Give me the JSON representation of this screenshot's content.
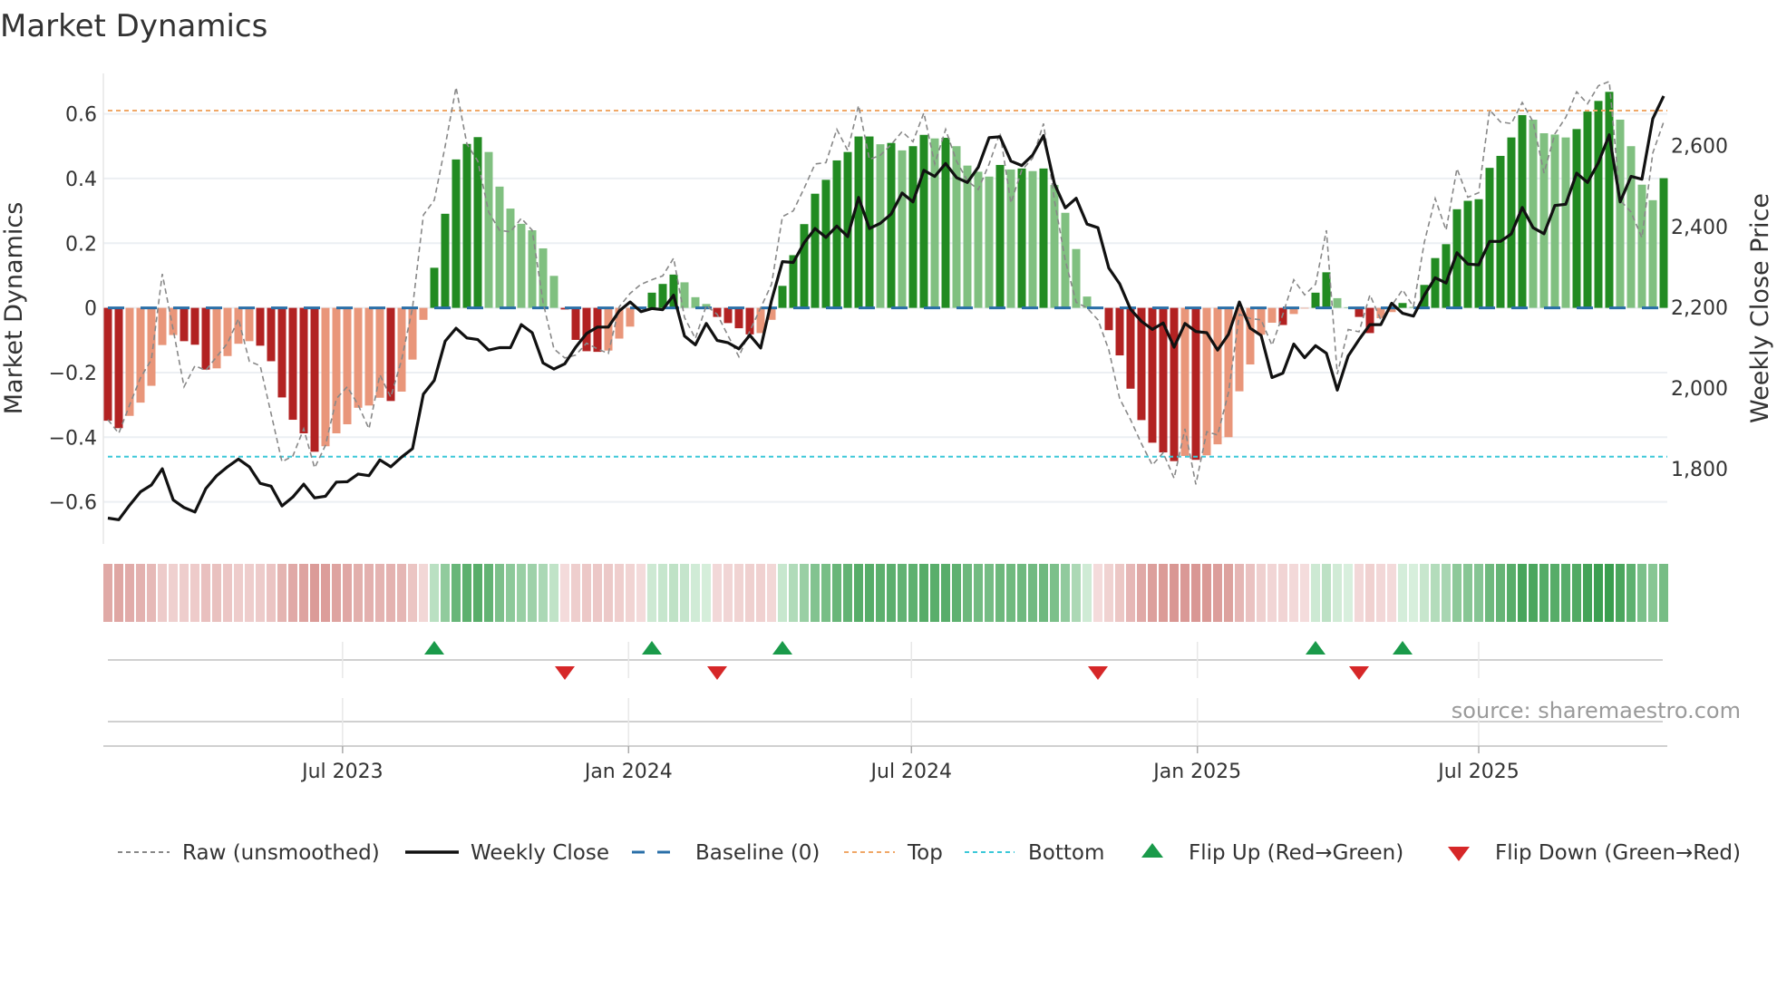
{
  "title": "Market Dynamics",
  "source": "source: sharemaestro.com",
  "colors": {
    "bar_pos_strong": "#228b22",
    "bar_pos_weak": "#80c080",
    "bar_neg_strong": "#b22222",
    "bar_neg_weak": "#e9967a",
    "raw": "#888888",
    "close": "#111111",
    "baseline": "#2a6fa8",
    "top": "#f0a868",
    "bottom": "#3cc8d8",
    "flip_up": "#1a9a4a",
    "flip_down": "#d62728",
    "grid": "#eceff3",
    "axis": "#d0d0d0"
  },
  "chart_data": {
    "type": "bar",
    "title": "Market Dynamics",
    "ylabel": "Market Dynamics",
    "y2label": "Weekly Close Price",
    "frequency": "weekly",
    "start_date": "2023-01-31",
    "ylim": [
      -0.73,
      0.725
    ],
    "y2lim": [
      1614,
      2779
    ],
    "yticks": [
      {
        "value": -0.6,
        "label": "−0.6"
      },
      {
        "value": -0.4,
        "label": "−0.4"
      },
      {
        "value": -0.2,
        "label": "−0.2"
      },
      {
        "value": 0,
        "label": "0"
      },
      {
        "value": 0.2,
        "label": "0.2"
      },
      {
        "value": 0.4,
        "label": "0.4"
      },
      {
        "value": 0.6,
        "label": "0.6"
      }
    ],
    "y2ticks": [
      {
        "value": 1800,
        "label": "1,800"
      },
      {
        "value": 2000,
        "label": "2,000"
      },
      {
        "value": 2200,
        "label": "2,200"
      },
      {
        "value": 2400,
        "label": "2,400"
      },
      {
        "value": 2600,
        "label": "2,600"
      }
    ],
    "xticks": [
      {
        "date": "2023-07-01",
        "label": "Jul 2023"
      },
      {
        "date": "2024-01-01",
        "label": "Jan 2024"
      },
      {
        "date": "2024-07-01",
        "label": "Jul 2024"
      },
      {
        "date": "2025-01-01",
        "label": "Jan 2025"
      },
      {
        "date": "2025-07-01",
        "label": "Jul 2025"
      }
    ],
    "top_level": 0.61,
    "bottom_level": -0.46,
    "baseline": 0,
    "grid": true,
    "legend_position": "bottom",
    "legend": [
      {
        "key": "raw",
        "label": "Raw (unsmoothed)"
      },
      {
        "key": "close",
        "label": "Weekly Close"
      },
      {
        "key": "baseline",
        "label": "Baseline (0)"
      },
      {
        "key": "top",
        "label": "Top"
      },
      {
        "key": "bottom",
        "label": "Bottom"
      },
      {
        "key": "flip_up",
        "label": "Flip Up (Red→Green)"
      },
      {
        "key": "flip_down",
        "label": "Flip Down (Green→Red)"
      }
    ],
    "dynamics": [
      -0.349,
      -0.372,
      -0.334,
      -0.293,
      -0.241,
      -0.115,
      -0.084,
      -0.103,
      -0.114,
      -0.191,
      -0.187,
      -0.149,
      -0.111,
      -0.103,
      -0.117,
      -0.165,
      -0.277,
      -0.346,
      -0.388,
      -0.445,
      -0.428,
      -0.388,
      -0.36,
      -0.309,
      -0.302,
      -0.278,
      -0.288,
      -0.259,
      -0.16,
      -0.037,
      0.124,
      0.291,
      0.459,
      0.507,
      0.528,
      0.482,
      0.375,
      0.307,
      0.26,
      0.24,
      0.184,
      0.099,
      -0.005,
      -0.099,
      -0.134,
      -0.136,
      -0.132,
      -0.095,
      -0.058,
      -0.005,
      0.047,
      0.074,
      0.103,
      0.079,
      0.033,
      0.012,
      -0.028,
      -0.047,
      -0.063,
      -0.082,
      -0.078,
      -0.037,
      0.068,
      0.163,
      0.259,
      0.353,
      0.396,
      0.456,
      0.482,
      0.53,
      0.53,
      0.506,
      0.51,
      0.487,
      0.5,
      0.535,
      0.524,
      0.526,
      0.5,
      0.44,
      0.421,
      0.406,
      0.442,
      0.428,
      0.431,
      0.423,
      0.431,
      0.38,
      0.294,
      0.182,
      0.035,
      -0.004,
      -0.069,
      -0.147,
      -0.25,
      -0.347,
      -0.417,
      -0.447,
      -0.474,
      -0.458,
      -0.47,
      -0.456,
      -0.422,
      -0.4,
      -0.258,
      -0.175,
      -0.083,
      -0.046,
      -0.053,
      -0.019,
      -0.002,
      0.047,
      0.11,
      0.03,
      0.002,
      -0.028,
      -0.078,
      -0.032,
      -0.013,
      0.015,
      0.003,
      0.071,
      0.154,
      0.197,
      0.305,
      0.331,
      0.336,
      0.433,
      0.47,
      0.527,
      0.596,
      0.582,
      0.54,
      0.536,
      0.527,
      0.553,
      0.607,
      0.64,
      0.668,
      0.582,
      0.5,
      0.381,
      0.333,
      0.401
    ],
    "raw": [
      -0.346,
      -0.388,
      -0.3,
      -0.216,
      -0.16,
      0.105,
      -0.067,
      -0.244,
      -0.179,
      -0.193,
      -0.151,
      -0.109,
      -0.034,
      -0.165,
      -0.179,
      -0.327,
      -0.476,
      -0.458,
      -0.374,
      -0.495,
      -0.425,
      -0.281,
      -0.244,
      -0.3,
      -0.374,
      -0.207,
      -0.276,
      -0.16,
      0,
      0.287,
      0.333,
      0.5,
      0.682,
      0.507,
      0.454,
      0.296,
      0.24,
      0.235,
      0.277,
      0.24,
      0.017,
      -0.127,
      -0.155,
      -0.146,
      -0.109,
      -0.127,
      -0.141,
      0.003,
      0.045,
      0.073,
      0.087,
      0.099,
      0.154,
      -0.03,
      -0.095,
      0.007,
      -0.02,
      -0.086,
      -0.151,
      -0.072,
      0,
      0.073,
      0.282,
      0.3,
      0.37,
      0.445,
      0.449,
      0.552,
      0.487,
      0.626,
      0.459,
      0.472,
      0.505,
      0.545,
      0.514,
      0.603,
      0.445,
      0.552,
      0.454,
      0.393,
      0.366,
      0.445,
      0.542,
      0.324,
      0.426,
      0.463,
      0.57,
      0.333,
      0.147,
      0.017,
      0,
      -0.037,
      -0.13,
      -0.281,
      -0.346,
      -0.42,
      -0.486,
      -0.448,
      -0.527,
      -0.374,
      -0.546,
      -0.383,
      -0.393,
      -0.262,
      -0.02,
      -0.033,
      -0.037,
      -0.116,
      -0.02,
      0.087,
      0.04,
      0.073,
      0.24,
      -0.205,
      -0.067,
      -0.074,
      0.04,
      -0.037,
      0.007,
      0.056,
      0.003,
      0.203,
      0.338,
      0.24,
      0.431,
      0.342,
      0.356,
      0.612,
      0.575,
      0.57,
      0.635,
      0.575,
      0.417,
      0.538,
      0.589,
      0.668,
      0.631,
      0.687,
      0.7,
      0.333,
      0.296,
      0.217,
      0.479,
      0.575
    ],
    "weekly_close": [
      1678,
      1674,
      1710,
      1743,
      1760,
      1800,
      1723,
      1704,
      1693,
      1751,
      1783,
      1805,
      1824,
      1805,
      1764,
      1757,
      1708,
      1730,
      1762,
      1728,
      1732,
      1767,
      1768,
      1787,
      1783,
      1822,
      1805,
      1829,
      1850,
      1985,
      2019,
      2116,
      2148,
      2124,
      2120,
      2094,
      2100,
      2100,
      2157,
      2137,
      2062,
      2047,
      2060,
      2101,
      2135,
      2151,
      2151,
      2191,
      2213,
      2189,
      2197,
      2194,
      2230,
      2129,
      2107,
      2160,
      2118,
      2112,
      2097,
      2131,
      2099,
      2217,
      2313,
      2311,
      2360,
      2395,
      2373,
      2401,
      2375,
      2472,
      2395,
      2408,
      2431,
      2483,
      2461,
      2539,
      2524,
      2556,
      2521,
      2509,
      2547,
      2620,
      2622,
      2562,
      2551,
      2577,
      2625,
      2506,
      2446,
      2470,
      2406,
      2397,
      2297,
      2258,
      2195,
      2165,
      2145,
      2161,
      2101,
      2160,
      2140,
      2137,
      2094,
      2133,
      2213,
      2148,
      2130,
      2026,
      2037,
      2109,
      2075,
      2105,
      2086,
      1995,
      2079,
      2120,
      2157,
      2157,
      2210,
      2185,
      2178,
      2230,
      2273,
      2260,
      2335,
      2307,
      2305,
      2363,
      2363,
      2382,
      2447,
      2397,
      2382,
      2452,
      2455,
      2532,
      2509,
      2558,
      2627,
      2461,
      2524,
      2517,
      2667,
      2723
    ],
    "flip_up_weeks": [
      31,
      51,
      63,
      112,
      120
    ],
    "flip_down_weeks": [
      43,
      57,
      92,
      116
    ]
  }
}
